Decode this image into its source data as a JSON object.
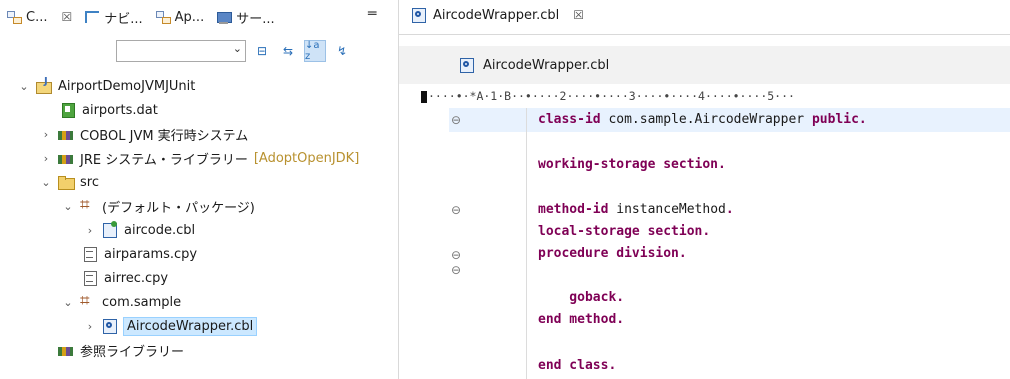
{
  "left_tabs": [
    {
      "icon": "package-explorer-icon",
      "label": "C...",
      "close": "☒"
    },
    {
      "icon": "navigator-icon",
      "label": "ナビ..."
    },
    {
      "icon": "application-icon",
      "label": "Ap..."
    },
    {
      "icon": "server-icon",
      "label": "サー..."
    }
  ],
  "minimize": "═",
  "toolbar": {
    "combo_arrow": "⌄",
    "collapse": "⊟",
    "link": "⇆",
    "sort": "↓a z",
    "filter": "↯"
  },
  "tree": [
    {
      "id": "project",
      "label": "AirportDemoJVMJUnit",
      "twisty": "⌄",
      "icon": "java-project-icon"
    },
    {
      "id": "airports-dat",
      "label": "airports.dat",
      "twisty": "",
      "icon": "data-file-icon"
    },
    {
      "id": "cobol-jvm",
      "label": "COBOL JVM 実行時システム",
      "twisty": "›",
      "icon": "library-icon"
    },
    {
      "id": "jre",
      "label": "JRE システム・ライブラリー",
      "decoration": "[AdoptOpenJDK]",
      "twisty": "›",
      "icon": "library-icon"
    },
    {
      "id": "src",
      "label": "src",
      "twisty": "⌄",
      "icon": "source-folder-icon"
    },
    {
      "id": "default-pkg",
      "label": "(デフォルト・パッケージ)",
      "twisty": "⌄",
      "icon": "package-icon"
    },
    {
      "id": "aircode",
      "label": "aircode.cbl",
      "twisty": "›",
      "icon": "cobol-program-icon"
    },
    {
      "id": "airparams",
      "label": "airparams.cpy",
      "twisty": "",
      "icon": "copybook-icon"
    },
    {
      "id": "airrec",
      "label": "airrec.cpy",
      "twisty": "",
      "icon": "copybook-icon"
    },
    {
      "id": "com-sample",
      "label": "com.sample",
      "twisty": "⌄",
      "icon": "package-icon"
    },
    {
      "id": "wrapper",
      "label": "AircodeWrapper.cbl",
      "twisty": "›",
      "icon": "cobol-class-icon"
    },
    {
      "id": "ref-lib",
      "label": "参照ライブラリー",
      "twisty": "",
      "icon": "library-icon"
    }
  ],
  "editor": {
    "tab_label": "AircodeWrapper.cbl",
    "tab_close": "☒",
    "filebar_label": "AircodeWrapper.cbl",
    "ruler": "····•·*A·1·B··•····2····•····3····•····4····•····5···",
    "fold_marker": "⊖",
    "lines": [
      {
        "kw": "class-id",
        "rest": " com.sample.AircodeWrapper",
        "kw2": " public."
      },
      {
        "kw": "",
        "rest": "",
        "kw2": ""
      },
      {
        "kw": "working-storage section.",
        "rest": "",
        "kw2": ""
      },
      {
        "kw": "",
        "rest": "",
        "kw2": ""
      },
      {
        "kw": "method-id",
        "rest": " instanceMethod",
        "kw2": "."
      },
      {
        "kw": "local-storage section.",
        "rest": "",
        "kw2": ""
      },
      {
        "kw": "procedure division.",
        "rest": "",
        "kw2": ""
      },
      {
        "kw": "",
        "rest": "",
        "kw2": ""
      },
      {
        "kw": "    goback.",
        "rest": "",
        "kw2": ""
      },
      {
        "kw": "end method.",
        "rest": "",
        "kw2": ""
      },
      {
        "kw": "",
        "rest": "",
        "kw2": ""
      },
      {
        "kw": "end class.",
        "rest": "",
        "kw2": ""
      }
    ]
  }
}
